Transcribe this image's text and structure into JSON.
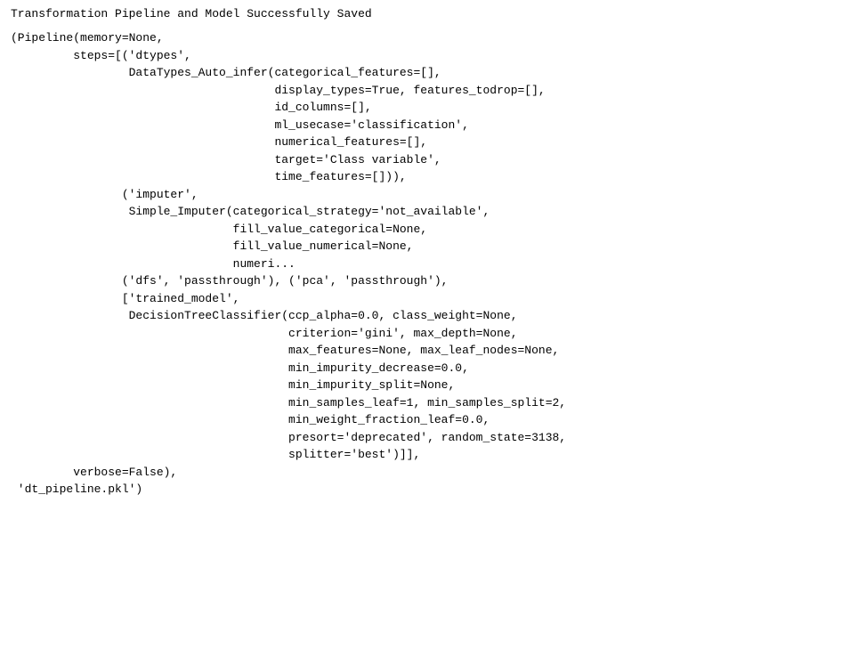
{
  "title": {
    "text": "Transformation Pipeline and Model Successfully Saved"
  },
  "code": {
    "content": "(Pipeline(memory=None,\n         steps=[('dtypes',\n                 DataTypes_Auto_infer(categorical_features=[],\n                                      display_types=True, features_todrop=[],\n                                      id_columns=[],\n                                      ml_usecase='classification',\n                                      numerical_features=[],\n                                      target='Class variable',\n                                      time_features=[])),\n                ('imputer',\n                 Simple_Imputer(categorical_strategy='not_available',\n                                fill_value_categorical=None,\n                                fill_value_numerical=None,\n                                numeri...\n                ('dfs', 'passthrough'), ('pca', 'passthrough'),\n                ['trained_model',\n                 DecisionTreeClassifier(ccp_alpha=0.0, class_weight=None,\n                                        criterion='gini', max_depth=None,\n                                        max_features=None, max_leaf_nodes=None,\n                                        min_impurity_decrease=0.0,\n                                        min_impurity_split=None,\n                                        min_samples_leaf=1, min_samples_split=2,\n                                        min_weight_fraction_leaf=0.0,\n                                        presort='deprecated', random_state=3138,\n                                        splitter='best')]],\n         verbose=False),\n 'dt_pipeline.pkl')"
  }
}
